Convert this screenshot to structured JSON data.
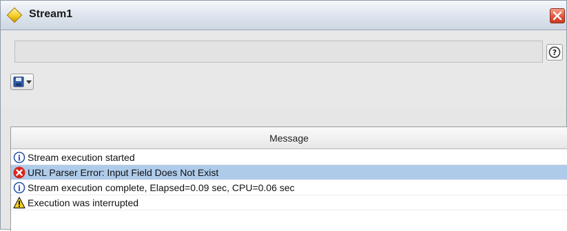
{
  "window": {
    "title": "Stream1"
  },
  "toolbar": {
    "status_text": "",
    "help_icon": "help-icon",
    "save_icon": "save-disk-icon",
    "dropdown_icon": "caret-down-icon"
  },
  "table": {
    "column_header": "Message",
    "rows": [
      {
        "icon": "info-icon",
        "message": "Stream execution started",
        "selected": false
      },
      {
        "icon": "error-icon",
        "message": "URL Parser Error: Input Field Does Not Exist",
        "selected": true
      },
      {
        "icon": "info-icon",
        "message": "Stream execution complete, Elapsed=0.09 sec, CPU=0.06 sec",
        "selected": false
      },
      {
        "icon": "warning-icon",
        "message": "Execution was interrupted",
        "selected": false
      }
    ]
  },
  "colors": {
    "selection": "#aecbea",
    "close_button": "#e2563c",
    "title_bar": "#dfe6ef"
  }
}
